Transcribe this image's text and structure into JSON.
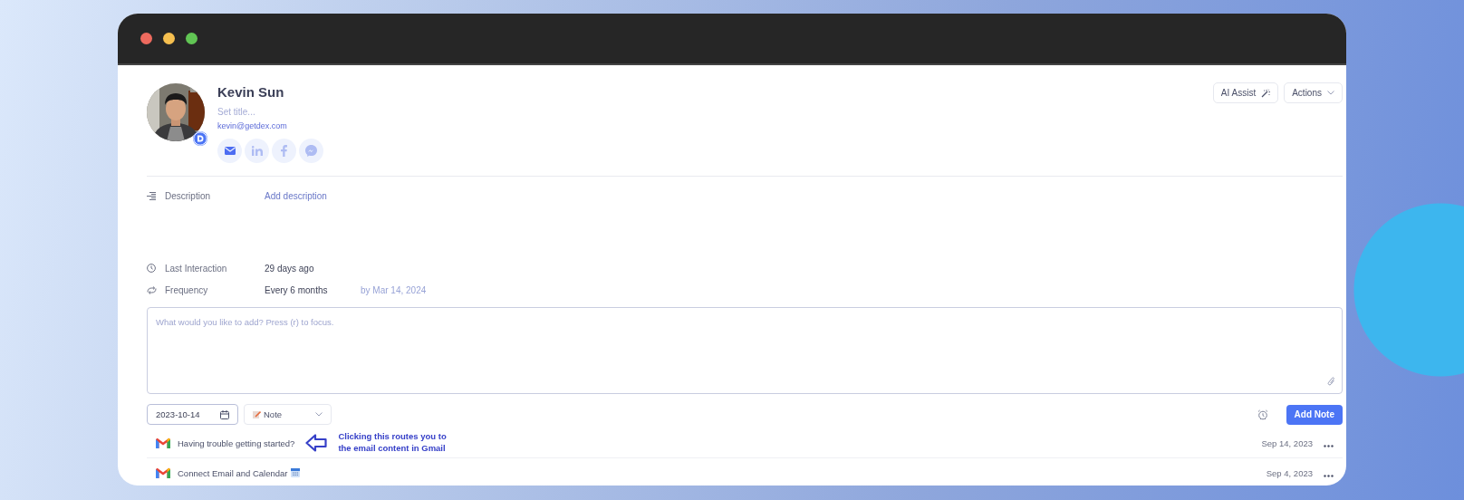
{
  "window": {
    "controls": [
      {
        "color": "#ed6a5e"
      },
      {
        "color": "#f5bf4f"
      },
      {
        "color": "#61c554"
      }
    ]
  },
  "contact": {
    "name": "Kevin Sun",
    "title_placeholder": "Set title...",
    "email": "kevin@getdex.com",
    "socials": [
      {
        "kind": "email"
      },
      {
        "kind": "linkedin"
      },
      {
        "kind": "facebook"
      },
      {
        "kind": "messenger"
      }
    ]
  },
  "header_buttons": [
    {
      "kind": "ai",
      "label": "AI Assist"
    },
    {
      "kind": "dropdown",
      "label": "Actions"
    }
  ],
  "fields": [
    {
      "kind": "description",
      "label": "Description",
      "value": "Add description"
    },
    {
      "kind": "last_interaction",
      "label": "Last Interaction",
      "value": "29 days ago"
    },
    {
      "kind": "frequency",
      "label": "Frequency",
      "value": "Every 6 months",
      "due": "by Mar 14, 2024"
    }
  ],
  "note": {
    "placeholder": "What would you like to add? Press (r) to focus."
  },
  "composer": {
    "date": "2023-10-14",
    "type": "Note",
    "submit": "Add Note"
  },
  "activities": [
    {
      "subject": "Having trouble getting started?",
      "date": "Sep 14, 2023",
      "calendar_icon": false
    },
    {
      "subject": "Connect Email and Calendar",
      "date": "Sep 4, 2023",
      "calendar_icon": true
    }
  ],
  "annotation": {
    "text": "Clicking this routes you to\nthe email content in Gmail"
  }
}
